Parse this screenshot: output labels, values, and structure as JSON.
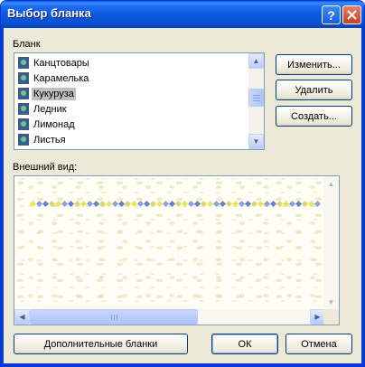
{
  "window": {
    "title": "Выбор бланка"
  },
  "titlebar": {
    "help_glyph": "?"
  },
  "labels": {
    "blank": "Бланк",
    "preview": "Внешний вид:"
  },
  "list": {
    "items": [
      {
        "label": "Канцтовары",
        "selected": false
      },
      {
        "label": "Карамелька",
        "selected": false
      },
      {
        "label": "Кукуруза",
        "selected": true
      },
      {
        "label": "Ледник",
        "selected": false
      },
      {
        "label": "Лимонад",
        "selected": false
      },
      {
        "label": "Листья",
        "selected": false
      }
    ],
    "scroll_arrows": {
      "up": "▲",
      "down": "▼"
    }
  },
  "buttons": {
    "change": "Изменить...",
    "delete": "Удалить",
    "create": "Создать...",
    "more_blanks": "Дополнительные бланки",
    "ok": "ОК",
    "cancel": "Отмена"
  },
  "preview": {
    "diamond_colors": [
      "#e7e35a",
      "#8aa0e0",
      "#6a7fd0",
      "#d9d96a"
    ],
    "scroll_arrows": {
      "up": "▲",
      "down": "▼",
      "left": "◀",
      "right": "▶"
    }
  }
}
